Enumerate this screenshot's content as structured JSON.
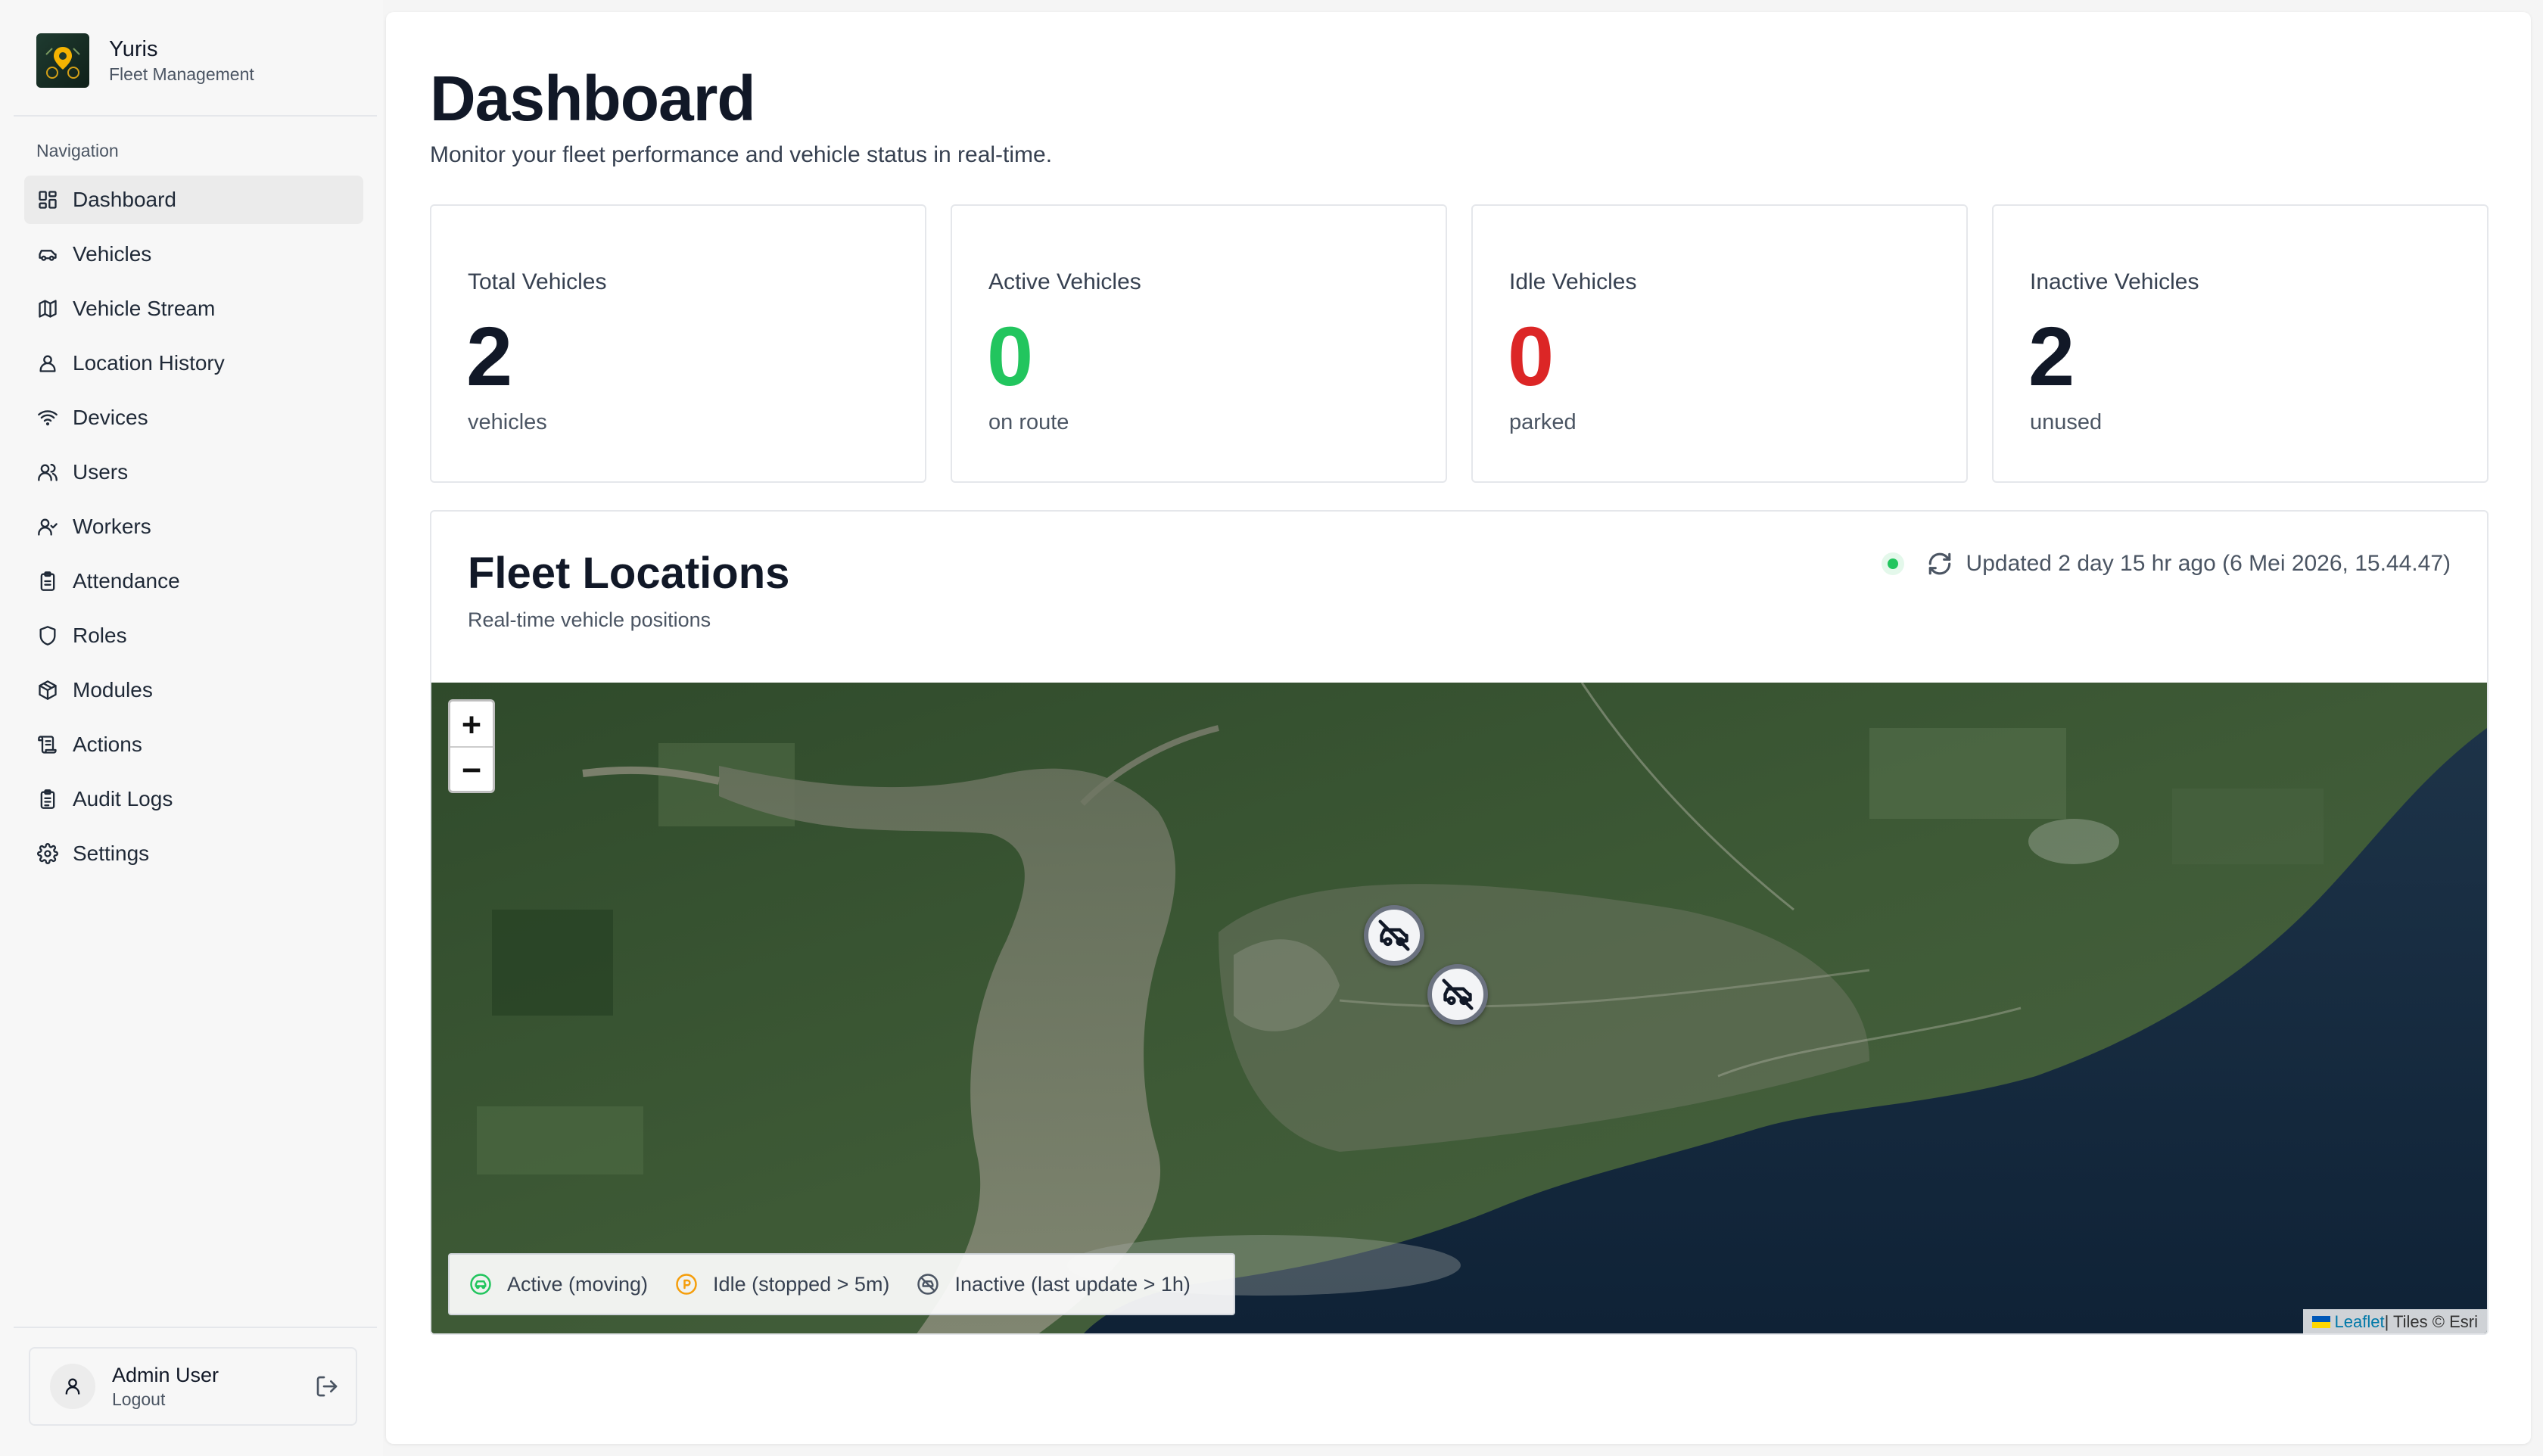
{
  "brand": {
    "name": "Yuris",
    "subtitle": "Fleet Management"
  },
  "sidebar": {
    "heading": "Navigation",
    "items": [
      {
        "label": "Dashboard",
        "icon": "dashboard-icon",
        "active": true
      },
      {
        "label": "Vehicles",
        "icon": "car-icon"
      },
      {
        "label": "Vehicle Stream",
        "icon": "map-icon"
      },
      {
        "label": "Location History",
        "icon": "user-location-icon"
      },
      {
        "label": "Devices",
        "icon": "wifi-icon"
      },
      {
        "label": "Users",
        "icon": "users-icon"
      },
      {
        "label": "Workers",
        "icon": "user-check-icon"
      },
      {
        "label": "Attendance",
        "icon": "clipboard-icon"
      },
      {
        "label": "Roles",
        "icon": "shield-icon"
      },
      {
        "label": "Modules",
        "icon": "package-icon"
      },
      {
        "label": "Actions",
        "icon": "scroll-icon"
      },
      {
        "label": "Audit Logs",
        "icon": "clipboard-list-icon"
      },
      {
        "label": "Settings",
        "icon": "settings-icon"
      }
    ]
  },
  "user": {
    "name": "Admin User",
    "action": "Logout"
  },
  "page": {
    "title": "Dashboard",
    "subtitle": "Monitor your fleet performance and vehicle status in real-time."
  },
  "stats": [
    {
      "label": "Total Vehicles",
      "value": "2",
      "unit": "vehicles",
      "color": "#111827"
    },
    {
      "label": "Active Vehicles",
      "value": "0",
      "unit": "on route",
      "color": "#22c55e"
    },
    {
      "label": "Idle Vehicles",
      "value": "0",
      "unit": "parked",
      "color": "#dc2626"
    },
    {
      "label": "Inactive Vehicles",
      "value": "2",
      "unit": "unused",
      "color": "#111827"
    }
  ],
  "fleet": {
    "title": "Fleet Locations",
    "subtitle": "Real-time vehicle positions",
    "status": "Updated 2 day 15 hr ago (6 Mei 2026, 15.44.47)",
    "zoom_in": "+",
    "zoom_out": "−",
    "legend": [
      {
        "label": "Active (moving)",
        "icon": "active-car-icon",
        "color": "#22c55e"
      },
      {
        "label": "Idle (stopped > 5m)",
        "icon": "idle-clock-icon",
        "color": "#f59e0b"
      },
      {
        "label": "Inactive (last update > 1h)",
        "icon": "inactive-icon",
        "color": "#4b5563"
      }
    ],
    "attribution": {
      "leaflet": "Leaflet",
      "tiles": " | Tiles © Esri"
    }
  }
}
